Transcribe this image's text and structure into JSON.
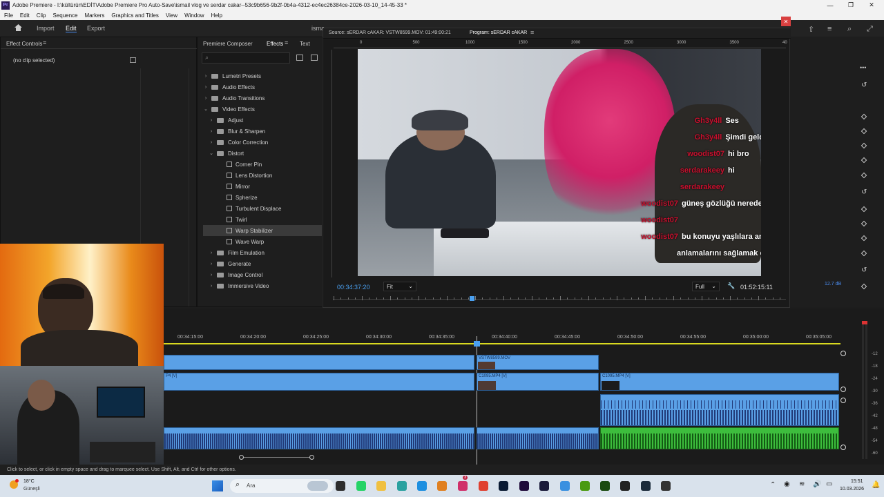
{
  "window": {
    "title": "Adobe Premiere - I:\\kültürün\\EDİT\\Adobe Premiere Pro Auto-Save\\ismail vlog ve serdar cakar--53c9b656-9b2f-0b4a-4312-ec4ec26384ce-2026-03-10_14-45-33 *",
    "app_icon": "Pr"
  },
  "menu": [
    "File",
    "Edit",
    "Clip",
    "Sequence",
    "Markers",
    "Graphics and Titles",
    "View",
    "Window",
    "Help"
  ],
  "workspace": {
    "home_icon": "home-icon",
    "tabs": [
      "Import",
      "Edit",
      "Export"
    ],
    "active": "Edit",
    "project_short": "isma"
  },
  "effect_controls": {
    "title": "Effect Controls",
    "no_clip": "(no clip selected)"
  },
  "effects_panel": {
    "tabs": [
      "Premiere Composer",
      "Effects",
      "Text"
    ],
    "active": "Effects",
    "items": [
      {
        "label": "Lumetri Presets",
        "level": 0,
        "type": "folder",
        "open": false
      },
      {
        "label": "Audio Effects",
        "level": 0,
        "type": "folder",
        "open": false
      },
      {
        "label": "Audio Transitions",
        "level": 0,
        "type": "folder",
        "open": false
      },
      {
        "label": "Video Effects",
        "level": 0,
        "type": "folder",
        "open": true
      },
      {
        "label": "Adjust",
        "level": 1,
        "type": "folder",
        "open": false
      },
      {
        "label": "Blur & Sharpen",
        "level": 1,
        "type": "folder",
        "open": false
      },
      {
        "label": "Color Correction",
        "level": 1,
        "type": "folder",
        "open": false
      },
      {
        "label": "Distort",
        "level": 1,
        "type": "folder",
        "open": true
      },
      {
        "label": "Corner Pin",
        "level": 2,
        "type": "effect"
      },
      {
        "label": "Lens Distortion",
        "level": 2,
        "type": "effect"
      },
      {
        "label": "Mirror",
        "level": 2,
        "type": "effect"
      },
      {
        "label": "Spherize",
        "level": 2,
        "type": "effect"
      },
      {
        "label": "Turbulent Displace",
        "level": 2,
        "type": "effect"
      },
      {
        "label": "Twirl",
        "level": 2,
        "type": "effect"
      },
      {
        "label": "Warp Stabilizer",
        "level": 2,
        "type": "effect",
        "selected": true
      },
      {
        "label": "Wave Warp",
        "level": 2,
        "type": "effect"
      },
      {
        "label": "Film Emulation",
        "level": 1,
        "type": "folder",
        "open": false
      },
      {
        "label": "Generate",
        "level": 1,
        "type": "folder",
        "open": false
      },
      {
        "label": "Image Control",
        "level": 1,
        "type": "folder",
        "open": false
      },
      {
        "label": "Immersive Video",
        "level": 1,
        "type": "folder",
        "open": false
      }
    ]
  },
  "monitor": {
    "source_tab": "Source: sERDAR cAKAR: VSTW8599.MOV: 01:49:00:21",
    "program_tab": "Program: sERDAR cAKAR",
    "ruler": [
      "0",
      "500",
      "1000",
      "1500",
      "2000",
      "2500",
      "3000",
      "3500",
      "40"
    ],
    "timecode": "00:34:37:20",
    "fit": "Fit",
    "quality": "Full",
    "duration": "01:52:15:11",
    "close_icon": "close-icon"
  },
  "chat": [
    {
      "user": "Gh3y4ll",
      "msg": "Ses"
    },
    {
      "user": "Gh3y4ll",
      "msg": "Şimdi geldi"
    },
    {
      "user": "woodist07",
      "msg": "hi bro"
    },
    {
      "user": "serdarakeey",
      "msg": "hi"
    },
    {
      "user": "serdarakeey",
      "msg": ""
    },
    {
      "user": "woodist07",
      "msg": "güneş gözlüğü nerede"
    },
    {
      "user": "woodist07",
      "msg": ""
    },
    {
      "user": "woodist07",
      "msg": "bu konuyu yaşlılara anlatmak aradaki farkı"
    },
    {
      "user": "",
      "msg": "anlamalarını sağlamak çok zor"
    }
  ],
  "timeline": {
    "times": [
      "00:34:15:00",
      "00:34:20:00",
      "00:34:25:00",
      "00:34:30:00",
      "00:34:35:00",
      "00:34:40:00",
      "00:34:45:00",
      "00:34:50:00",
      "00:34:55:00",
      "00:35:00:00",
      "00:35:05:00"
    ],
    "clips": {
      "v2": "VSTW8599.MOV",
      "v1_left": "P4 [V]",
      "v1_mid": "C1095.MP4 [V]",
      "v1_right": "C1095.MP4 [V]"
    },
    "meter": [
      "-12",
      "-18",
      "-24",
      "-30",
      "-36",
      "-42",
      "-48",
      "-54",
      "-60"
    ],
    "db": "12.7 dB"
  },
  "status": "Click to select, or click in empty space and drag to marquee select. Use Shift, Alt, and Ctrl for other options.",
  "taskbar": {
    "weather_temp": "18°C",
    "weather_loc": "Güneşli",
    "search": "Ara",
    "time": "15:51",
    "date": "10.03.2026",
    "badge": "3"
  }
}
